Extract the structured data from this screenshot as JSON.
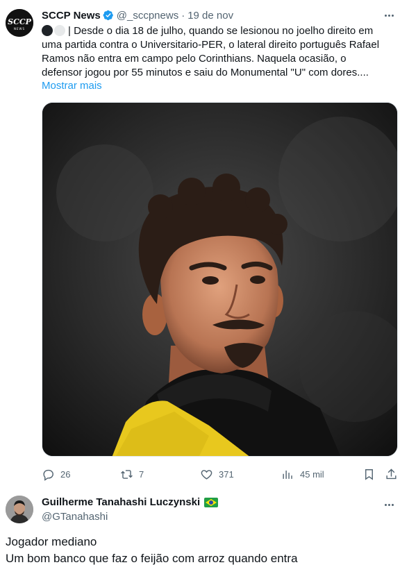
{
  "tweet": {
    "author_name": "SCCP News",
    "handle": "@_sccpnews",
    "separator": "·",
    "date": "19 de nov",
    "avatar_text": "SCCP",
    "avatar_subtext": "NEWS",
    "text": "| Desde o dia 18 de julho, quando se lesionou no joelho direito em uma partida contra o Universitario-PER, o lateral direito português Rafael Ramos não entra em campo pelo Corinthians. Naquela ocasião, o defensor jogou por 55 minutos e saiu do Monumental \"U\" com dores....",
    "show_more_label": "Mostrar mais",
    "more_icon": "ellipsis-icon",
    "verified_icon": "verified-badge-icon",
    "photo_alt": "player-photo"
  },
  "actions": {
    "reply_count": "26",
    "retweet_count": "7",
    "like_count": "371",
    "views_count": "45 mil"
  },
  "reply": {
    "author_name": "Guilherme Tanahashi Luczynski",
    "handle": "@GTanahashi",
    "flag_icon": "brazil-flag-icon",
    "line1": "Jogador mediano",
    "line2": "Um bom banco que faz o feijão com arroz quando entra"
  },
  "colors": {
    "accent": "#1d9bf0",
    "muted": "#536471",
    "text": "#0f1419",
    "jersey_yellow": "#e8c81e"
  }
}
